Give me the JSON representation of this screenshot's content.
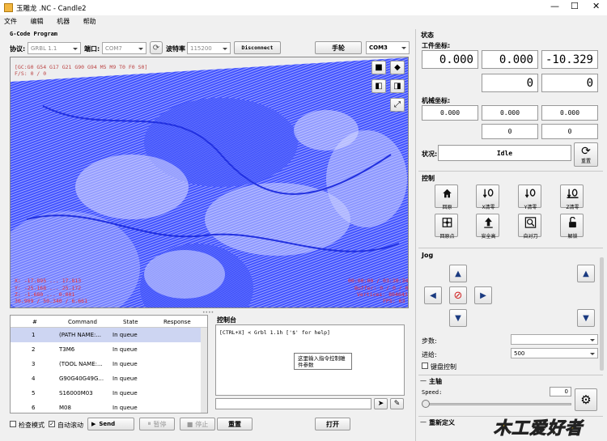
{
  "window": {
    "title": "玉雕龙 .NC - Candle2"
  },
  "menu": [
    "文件",
    "编辑",
    "机器",
    "帮助"
  ],
  "gcode_program": {
    "title": "G-Code Program",
    "protocol_label": "协议:",
    "protocol_value": "GRBL 1.1",
    "port_label": "端口:",
    "port_value": "COM7",
    "baud_label": "波特率",
    "baud_value": "115200",
    "disconnect_label": "Disconnect",
    "handwheel_label": "手轮",
    "com_value": "COM3"
  },
  "visualizer": {
    "status_line1": "[GC:G0 G54 G17 G21 G90 G94 M5 M9 T0 F0 S0]",
    "status_line2": "F/S: 0 / 0",
    "bottom_left": [
      "X: -17.895 ... 17.813",
      "Y: -25.168 ... 25.172",
      "Z: -1.680 ... 0.001",
      "30.909 / 50.340 / 6.661"
    ],
    "bottom_right": [
      "00:00:00 / 03:30:34",
      "Buffer: 0 / 0 / 0",
      "Vertices: 804643",
      "FPS: 63"
    ]
  },
  "table": {
    "headers": [
      "#",
      "Command",
      "State",
      "Response"
    ],
    "rows": [
      {
        "num": "1",
        "cmd": "(PATH NAME:...",
        "state": "In queue",
        "resp": ""
      },
      {
        "num": "2",
        "cmd": "T3M6",
        "state": "In queue",
        "resp": ""
      },
      {
        "num": "3",
        "cmd": "(TOOL NAME:...",
        "state": "In queue",
        "resp": ""
      },
      {
        "num": "4",
        "cmd": "G90G40G49G...",
        "state": "In queue",
        "resp": ""
      },
      {
        "num": "5",
        "cmd": "S16000M03",
        "state": "In queue",
        "resp": ""
      },
      {
        "num": "6",
        "cmd": "M08",
        "state": "In queue",
        "resp": ""
      }
    ]
  },
  "console": {
    "title": "控制台",
    "text": "[CTRL+X] < Grbl 1.1h ['$' for help]",
    "tooltip_line1": "这里输入指令控制雕",
    "tooltip_line2": "件参数"
  },
  "bottom": {
    "check_mode": "检查模式",
    "auto_scroll": "自动滚动",
    "send": "Send",
    "pause": "暂停",
    "stop": "停止",
    "reset": "重置",
    "open": "打开"
  },
  "state": {
    "title": "状态",
    "work_coords_label": "工件坐标:",
    "work_x": "0.000",
    "work_y": "0.000",
    "work_z": "-10.329",
    "work_a": "0",
    "work_b": "0",
    "machine_coords_label": "机械坐标:",
    "mach_x": "0.000",
    "mach_y": "0.000",
    "mach_z": "0.000",
    "mach_a": "0",
    "mach_b": "0",
    "status_label": "状况:",
    "status_value": "Idle",
    "reset_label": "重置"
  },
  "control": {
    "title": "控制",
    "buttons": [
      "回原",
      "X清零",
      "Y清零",
      "Z清零",
      "回原点",
      "安全高",
      "自对刀",
      "解锁"
    ]
  },
  "jog": {
    "title": "Jog",
    "step_label": "步数:",
    "step_value": "",
    "feed_label": "进给:",
    "feed_value": "500",
    "keyboard_label": "键盘控制"
  },
  "spindle": {
    "title": "主轴",
    "speed_label": "Speed:",
    "speed_value": "0"
  },
  "user_commands": {
    "title": "重新定义"
  },
  "watermark": "木工爱好者"
}
